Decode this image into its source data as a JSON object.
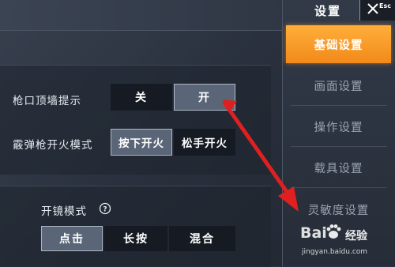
{
  "sidebar": {
    "title": "设置",
    "esc_label": "Esc",
    "items": [
      {
        "label": "基础设置",
        "active": true
      },
      {
        "label": "画面设置",
        "active": false
      },
      {
        "label": "操作设置",
        "active": false
      },
      {
        "label": "载具设置",
        "active": false
      },
      {
        "label": "灵敏度设置",
        "active": false
      }
    ]
  },
  "settings": {
    "muzzle_wall_hint": {
      "label": "枪口顶墙提示",
      "options": [
        "关",
        "开"
      ],
      "selected": "开"
    },
    "shotgun_fire_mode": {
      "label": "霰弹枪开火模式",
      "options": [
        "按下开火",
        "松手开火"
      ],
      "selected": "按下开火"
    },
    "scope_mode": {
      "label": "开镜模式",
      "help_icon": "question-circle-icon",
      "options": [
        "点击",
        "长按",
        "混合"
      ],
      "selected": "点击"
    }
  },
  "annotation": {
    "arrow_color": "#e02020",
    "icon": "red-arrow"
  },
  "watermark": {
    "brand": "Bai",
    "brand_suffix": "经验",
    "url": "jingyan.baidu.com"
  },
  "colors": {
    "accent": "#f59a22",
    "active_segment": "#5a6677",
    "inactive_segment": "#161b23"
  }
}
